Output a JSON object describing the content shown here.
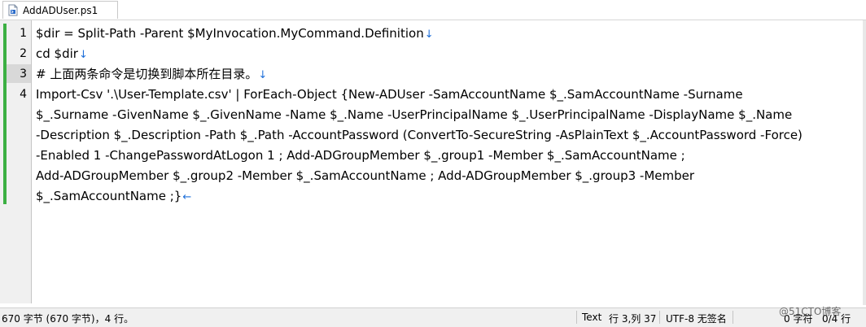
{
  "tab": {
    "label": "AddADUser.ps1",
    "icon": "powershell-file-icon"
  },
  "editor": {
    "line_numbers": [
      "1",
      "2",
      "3",
      "4"
    ],
    "lines": [
      "$dir = Split-Path -Parent $MyInvocation.MyCommand.Definition",
      "cd $dir",
      "# 上面两条命令是切换到脚本所在目录。",
      "Import-Csv '.\\User-Template.csv' | ForEach-Object {New-ADUser -SamAccountName $_.SamAccountName -Surname",
      "$_.Surname -GivenName $_.GivenName -Name $_.Name -UserPrincipalName $_.UserPrincipalName -DisplayName $_.Name",
      "-Description $_.Description -Path $_.Path -AccountPassword (ConvertTo-SecureString -AsPlainText $_.AccountPassword -Force)",
      "-Enabled 1 -ChangePasswordAtLogon 1 ; Add-ADGroupMember $_.group1 -Member $_.SamAccountName ;",
      "Add-ADGroupMember $_.group2 -Member $_.SamAccountName ; Add-ADGroupMember $_.group3 -Member",
      "$_.SamAccountName ;}"
    ],
    "eol_marks": [
      "↓",
      "↓",
      "↓",
      "",
      "",
      "",
      "",
      "",
      "←"
    ],
    "change_bar_color": "#3cb043"
  },
  "status": {
    "summary": "670 字节 (670 字节)，4 行。",
    "mode": "Text",
    "position": "行 3,列 37",
    "encoding": "UTF-8 无签名",
    "selection": "0 字符",
    "selection_bytes": "0/4 行"
  },
  "watermark": "@51CTO博客"
}
